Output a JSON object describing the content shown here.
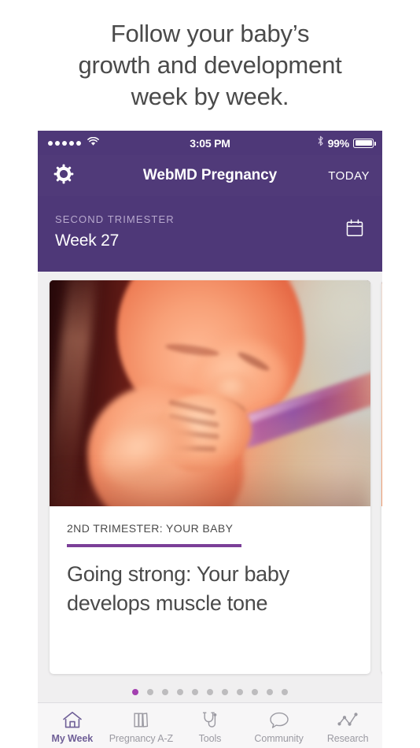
{
  "promo": {
    "headline": "Follow your baby’s\ngrowth and development\nweek by week."
  },
  "phone": {
    "status_bar": {
      "signal_dots": 5,
      "wifi_icon": "wifi-icon",
      "time": "3:05 PM",
      "bluetooth_icon": "bluetooth-icon",
      "battery_percent": "99%",
      "battery_level": 100
    },
    "nav_bar": {
      "settings_icon": "gear-icon",
      "title": "WebMD Pregnancy",
      "today_label": "TODAY"
    },
    "week_header": {
      "trimester": "SECOND TRIMESTER",
      "week": "Week 27",
      "calendar_icon": "calendar-icon"
    },
    "cards": [
      {
        "eyebrow": "2ND TRIMESTER: YOUR BABY",
        "title": "Going strong: Your baby\ndevelops muscle tone",
        "image": "fetus-week-27-illustration"
      },
      {
        "eyebrow": "",
        "title": "",
        "image": "next-card-illustration"
      }
    ],
    "pagination": {
      "total": 11,
      "active_index": 0
    },
    "tabs": [
      {
        "label": "My Week",
        "icon": "home-icon",
        "active": true
      },
      {
        "label": "Pregnancy A-Z",
        "icon": "books-icon",
        "active": false
      },
      {
        "label": "Tools",
        "icon": "stethoscope-icon",
        "active": false
      },
      {
        "label": "Community",
        "icon": "speech-bubble-icon",
        "active": false
      },
      {
        "label": "Research",
        "icon": "line-chart-icon",
        "active": false
      }
    ]
  },
  "colors": {
    "purple_dark": "#4E3878",
    "purple_nav": "#503A79",
    "accent_rule": "#7B3F98",
    "dot_active": "#A340B0",
    "tab_active": "#6F5F97",
    "tab_inactive": "#9B9AA2"
  }
}
